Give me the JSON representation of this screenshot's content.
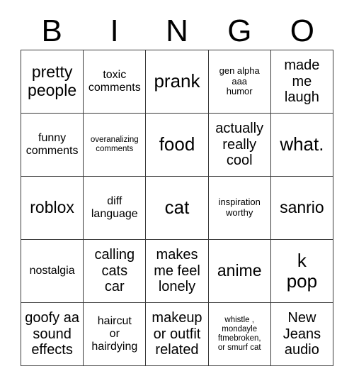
{
  "card": {
    "header_letters": [
      "B",
      "I",
      "N",
      "G",
      "O"
    ],
    "border_color": "#3a3a3a",
    "background_color": "#ffffff",
    "text_color": "#000000",
    "rows": [
      [
        {
          "text": "pretty\npeople",
          "size": "lg"
        },
        {
          "text": "toxic\ncomments",
          "size": "sm"
        },
        {
          "text": "prank",
          "size": "xl"
        },
        {
          "text": "gen alpha\naaa\nhumor",
          "size": "xs"
        },
        {
          "text": "made\nme\nlaugh",
          "size": "md"
        }
      ],
      [
        {
          "text": "funny\ncomments",
          "size": "sm"
        },
        {
          "text": "overanalizing\ncomments",
          "size": "xxs"
        },
        {
          "text": "food",
          "size": "xl"
        },
        {
          "text": "actually\nreally\ncool",
          "size": "md"
        },
        {
          "text": "what.",
          "size": "xl"
        }
      ],
      [
        {
          "text": "roblox",
          "size": "lg"
        },
        {
          "text": "diff\nlanguage",
          "size": "sm"
        },
        {
          "text": "cat",
          "size": "xl"
        },
        {
          "text": "inspiration\nworthy",
          "size": "xs"
        },
        {
          "text": "sanrio",
          "size": "lg"
        }
      ],
      [
        {
          "text": "nostalgia",
          "size": "sm"
        },
        {
          "text": "calling\ncats\ncar",
          "size": "md"
        },
        {
          "text": "makes\nme feel\nlonely",
          "size": "md"
        },
        {
          "text": "anime",
          "size": "lg"
        },
        {
          "text": "k\npop",
          "size": "xl"
        }
      ],
      [
        {
          "text": "goofy aa\nsound\neffects",
          "size": "md"
        },
        {
          "text": "haircut\nor\nhairdying",
          "size": "sm"
        },
        {
          "text": "makeup\nor outfit\nrelated",
          "size": "md"
        },
        {
          "text": "whistle ,\nmondayle\nftmebroken,\nor smurf cat",
          "size": "xxs"
        },
        {
          "text": "New\nJeans\naudio",
          "size": "md"
        }
      ]
    ]
  }
}
